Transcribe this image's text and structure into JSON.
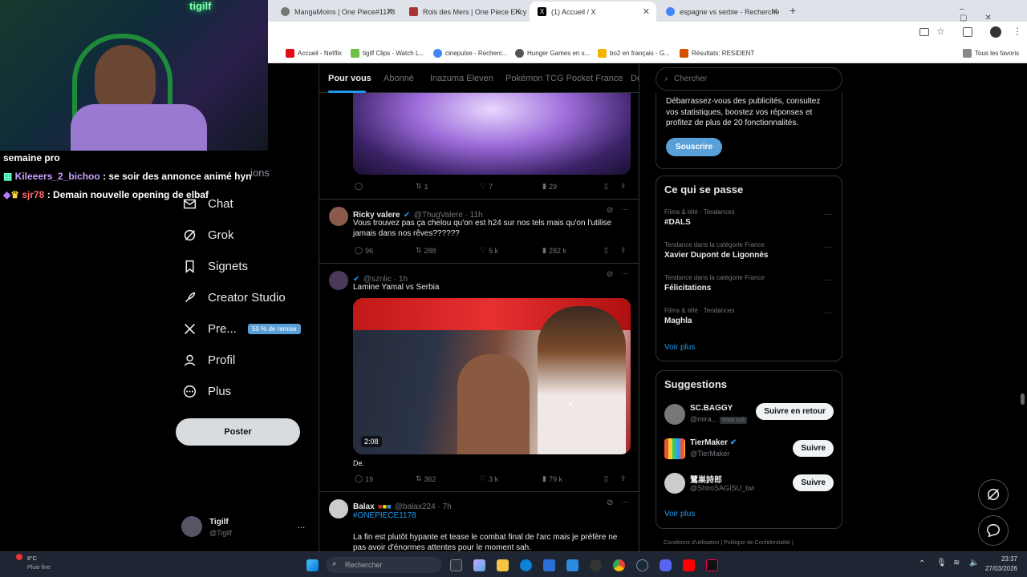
{
  "browser": {
    "tabs": [
      {
        "label": "MangaMoins | One Piece#1178",
        "color": "#555"
      },
      {
        "label": "Rois des Mers | One Piece Ency",
        "color": "#a33"
      },
      {
        "label": "(1) Accueil / X",
        "color": "#000"
      },
      {
        "label": "espagne vs serbie - Recherche",
        "color": "#4285f4"
      }
    ],
    "new_tab": "+",
    "bookmarks": [
      {
        "label": "Accueil - Netflix",
        "color": "#e50914"
      },
      {
        "label": "tigilf Clips - Watch L...",
        "color": "#6cc04a"
      },
      {
        "label": "cinepulse - Recherc...",
        "color": "#4285f4"
      },
      {
        "label": "Hunger Games en s...",
        "color": "#555"
      },
      {
        "label": "bo2 en français - G...",
        "color": "#f4b400"
      },
      {
        "label": "Résultats: RESIDENT",
        "color": "#d35400"
      }
    ],
    "all_favs": "Tous les favoris"
  },
  "chat": [
    {
      "user": "",
      "msg": "semaine pro",
      "color": "#ffffff"
    },
    {
      "user": "Kileeers_2_bichoo",
      "msg": " : se soir des annonce animé hyn",
      "color": "#c8a2ff"
    },
    {
      "user": "sjr78",
      "msg": " : Demain nouvelle opening de elbaf",
      "color": "#ff6b6b"
    }
  ],
  "nav": {
    "notifications_partial": "ions",
    "items": [
      {
        "label": "Chat",
        "icon": "mail-icon"
      },
      {
        "label": "Grok",
        "icon": "grok-icon"
      },
      {
        "label": "Signets",
        "icon": "bookmark-icon"
      },
      {
        "label": "Creator Studio",
        "icon": "rocket-icon"
      },
      {
        "label": "Pre...",
        "icon": "x-logo-icon"
      },
      {
        "label": "Profil",
        "icon": "person-icon"
      },
      {
        "label": "Plus",
        "icon": "more-circle-icon"
      }
    ],
    "premium_badge": "50 % de remise",
    "post_button": "Poster",
    "account_name": "Tigilf",
    "account_handle": "@Tigilf",
    "account_more": "..."
  },
  "feed": {
    "tabs": [
      "Pour vous",
      "Abonné",
      "Inazuma Eleven",
      "Pokémon TCG Pocket France",
      "De"
    ],
    "post0": {
      "replies": "",
      "reposts": "1",
      "likes": "7",
      "views": "29"
    },
    "post1": {
      "name": "Ricky valere",
      "handle": "@ThugValere · 11h",
      "text": "Vous trouvez pas ça chelou qu'on est h24 sur nos tels mais qu'on l'utilise jamais dans nos rêves??????",
      "replies": "96",
      "reposts": "288",
      "likes": "5 k",
      "views": "282 k"
    },
    "post2": {
      "handle": "@sznlic · 1h",
      "text": "Lamine Yamal vs Serbia",
      "duration": "2:08",
      "caption": "De.",
      "replies": "19",
      "reposts": "362",
      "likes": "3 k",
      "views": "79 k"
    },
    "post3": {
      "name": "Balax",
      "handle": "@balax224 · 7h",
      "hashtag": "#ONEPIECE1178",
      "text": "La fin est plutôt hypante et tease le combat final de l'arc mais je préfère ne pas avoir d'énormes attentes pour le moment sah."
    }
  },
  "right": {
    "search_placeholder": "Chercher",
    "premium_text": "Débarrassez-vous des publicités, consultez vos statistiques, boostez vos réponses et profitez de plus de 20 fonctionnalités.",
    "subscribe": "Souscrire",
    "trends_title": "Ce qui se passe",
    "trends": [
      {
        "cat": "Films & télé · Tendances",
        "name": "#DALS"
      },
      {
        "cat": "Tendance dans la catégorie France",
        "name": "Xavier Dupont de Ligonnès"
      },
      {
        "cat": "Tendance dans la catégorie France",
        "name": "Félicitations"
      },
      {
        "cat": "Films & télé · Tendances",
        "name": "Maghla"
      }
    ],
    "see_more": "Voir plus",
    "sugg_title": "Suggestions",
    "suggestions": [
      {
        "name": "SC.BAGGY",
        "handle": "@mira...",
        "tag": "Vous suit",
        "button": "Suivre en retour"
      },
      {
        "name": "TierMaker",
        "handle": "@TierMaker",
        "tag": "",
        "button": "Suivre"
      },
      {
        "name": "鷺巣詩郎",
        "handle": "@ShiroSAGISU_twi",
        "tag": "",
        "button": "Suivre"
      }
    ],
    "sugg_more": "Voir plus",
    "footer": [
      "Conditions d'utilisation",
      "Politique de Confidentialité"
    ]
  },
  "taskbar": {
    "temp": "8°C",
    "weather": "Pluie fine",
    "search": "Rechercher",
    "time": "23:37",
    "date": "27/03/2026"
  }
}
